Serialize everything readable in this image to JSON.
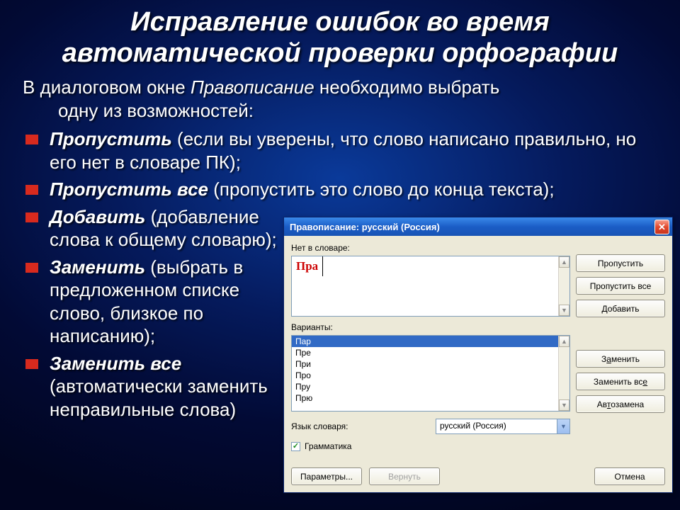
{
  "slide": {
    "title_l1": "Исправление ошибок во время",
    "title_l2": "автоматической проверки орфографии",
    "intro_pre": "В диалоговом окне ",
    "intro_ital": "Правописание",
    "intro_post": " необходимо выбрать",
    "intro_l2": "одну из возможностей:"
  },
  "bullets": [
    {
      "bold": "Пропустить",
      "rest": " (если вы уверены, что слово написано правильно, но его нет в словаре ПК);"
    },
    {
      "bold": "Пропустить все",
      "rest": "  (пропустить это слово до конца текста);"
    },
    {
      "bold": "Добавить",
      "rest": "  (добавление слова к общему словарю);"
    },
    {
      "bold": "Заменить",
      "rest": "  (выбрать в предложенном списке слово, близкое по написанию);"
    },
    {
      "bold": "Заменить все",
      "rest": " (автоматически заменить неправильные слова)"
    }
  ],
  "dialog": {
    "title": "Правописание: русский (Россия)",
    "close": "✕",
    "not_in_dict_label": "Нет в словаре:",
    "not_in_dict_word": "Пра",
    "variants_label": "Варианты:",
    "variants": [
      "Пар",
      "Пре",
      "При",
      "Про",
      "Пру",
      "Прю"
    ],
    "selected_variant_index": 0,
    "lang_label": "Язык словаря:",
    "lang_value": "русский (Россия)",
    "grammar_label": "Грамматика",
    "grammar_checked": true,
    "btn_skip": "Пропустить",
    "btn_skip_all": "Пропустить все",
    "btn_add": "Добавить",
    "btn_replace_pre": "З",
    "btn_replace_u": "а",
    "btn_replace_post": "менить",
    "btn_replace_all": "Заменить вс",
    "btn_replace_all_u": "е",
    "btn_auto_pre": "Ав",
    "btn_auto_u": "т",
    "btn_auto_post": "озамена",
    "btn_params": "Параметры...",
    "btn_revert": "Вернуть",
    "btn_cancel": "Отмена"
  }
}
